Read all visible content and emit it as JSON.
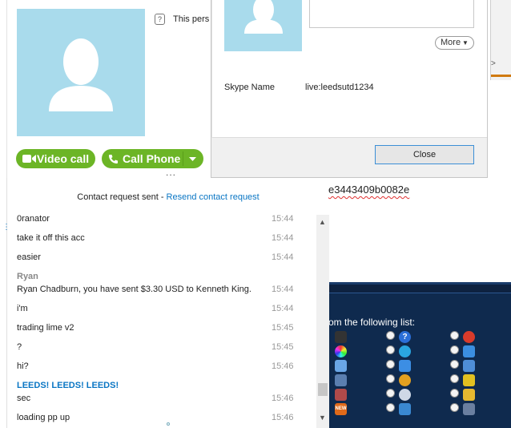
{
  "background": {
    "hash_fragment": "e3443409b0082e",
    "panel_title": "om the following list:"
  },
  "profile": {
    "info_text": "This pers",
    "video_call_label": "Video call",
    "call_phone_label": "Call Phone",
    "more_dots": "...",
    "info_icon": "?"
  },
  "chat": {
    "request_text": "Contact request sent - ",
    "request_link": "Resend contact request",
    "messages": [
      {
        "text": "0ranator",
        "time": "15:44"
      },
      {
        "text": "take it off this acc",
        "time": "15:44"
      },
      {
        "text": "easier",
        "time": "15:44"
      },
      {
        "text": "Ryan Chadburn, you have sent $3.30 USD to Kenneth King.",
        "time": "15:44"
      },
      {
        "text": "i'm",
        "time": "15:44"
      },
      {
        "text": "trading lime v2",
        "time": "15:45"
      },
      {
        "text": "?",
        "time": "15:45"
      },
      {
        "text": "hi?",
        "time": "15:46"
      },
      {
        "text": "sec",
        "time": "15:46"
      },
      {
        "text": "loading pp up",
        "time": "15:46"
      }
    ],
    "sender_ryan": "Ryan",
    "sender_leeds": "LEEDS! LEEDS! LEEDS!"
  },
  "dialog": {
    "more_label": "More",
    "skype_name_label": "Skype Name",
    "skype_name_value": "live:leedsutd1234",
    "close_label": "Close"
  },
  "colors": {
    "avatar_bg": "#a9dbec",
    "call_green": "#6cb526",
    "link_blue": "#0a76c4",
    "panel_navy": "#0f2a4e"
  }
}
